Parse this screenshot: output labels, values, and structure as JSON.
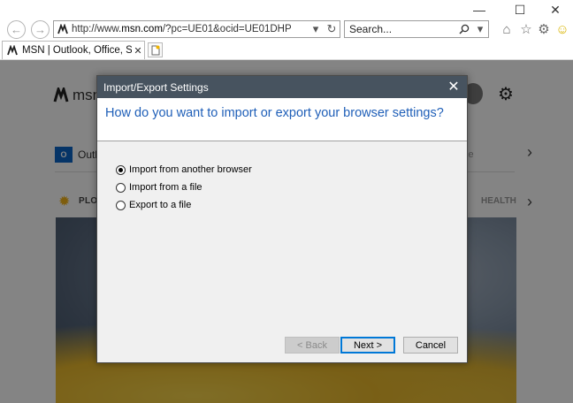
{
  "window": {
    "minimize": "—",
    "maximize": "☐",
    "close": "✕"
  },
  "address_bar": {
    "url_prefix": "http://www.",
    "url_domain": "msn.com",
    "url_rest": "/?pc=UE01&ocid=UE01DHP"
  },
  "search": {
    "placeholder": "Search..."
  },
  "tab": {
    "title": "MSN | Outlook, Office, Sky...",
    "close": "✕"
  },
  "page": {
    "logo_text": "msn",
    "outlook_text": "Outl",
    "ce_text": "ce",
    "section_left": "PLO",
    "section_right": "HEALTH"
  },
  "dialog": {
    "title": "Import/Export Settings",
    "heading": "How do you want to import or export your browser settings?",
    "options": [
      {
        "label": "Import from another browser",
        "selected": true
      },
      {
        "label": "Import from a file",
        "selected": false
      },
      {
        "label": "Export to a file",
        "selected": false
      }
    ],
    "buttons": {
      "back": "< Back",
      "next": "Next >",
      "cancel": "Cancel"
    }
  }
}
